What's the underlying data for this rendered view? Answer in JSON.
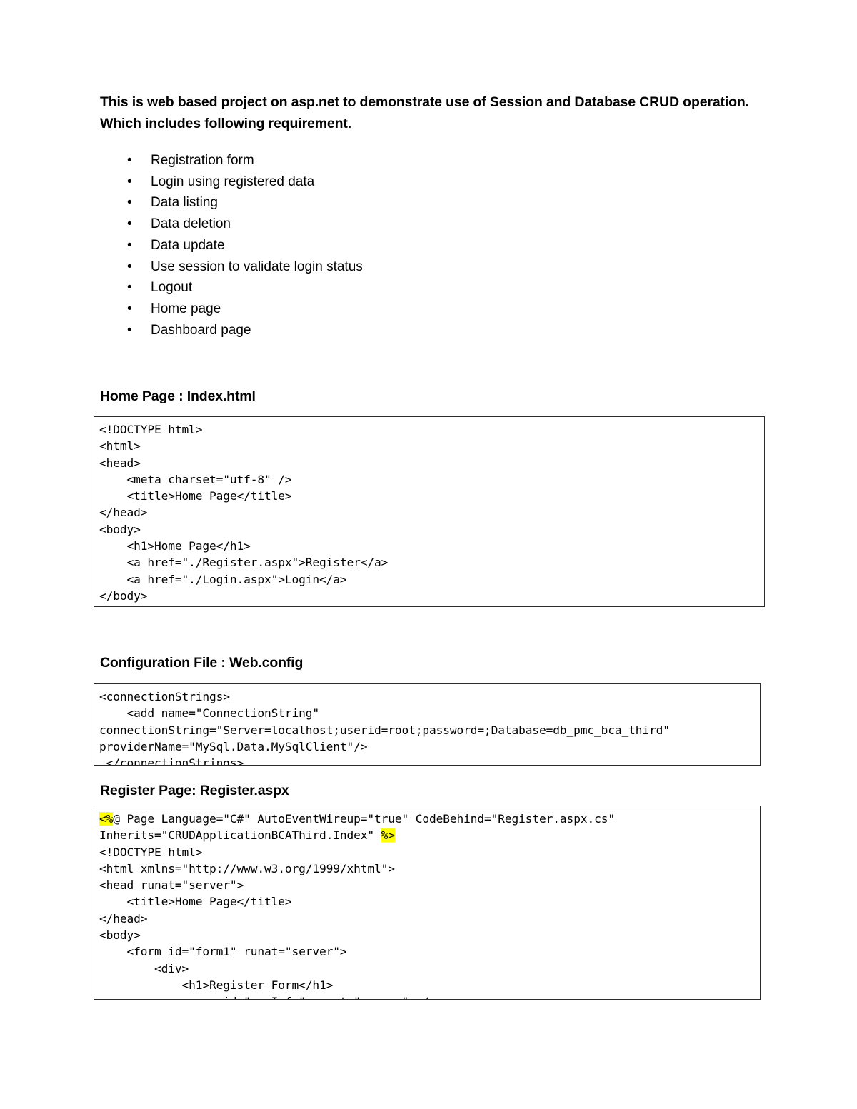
{
  "document": {
    "intro": {
      "line1": "This is web based project on asp.net to demonstrate use of Session and Database CRUD operation.",
      "line2": "Which includes following requirement."
    },
    "bullet_glyph": "•",
    "requirements": [
      "Registration form",
      "Login using registered data",
      "Data listing",
      "Data deletion",
      "Data update",
      "Use session to validate login status",
      "Logout",
      "Home page",
      "Dashboard page"
    ],
    "sections": [
      {
        "heading": "Home Page : Index.html",
        "code_id": "code-index",
        "code": "<!DOCTYPE html>\n<html>\n<head>\n    <meta charset=\"utf-8\" />\n    <title>Home Page</title>\n</head>\n<body>\n    <h1>Home Page</h1>\n    <a href=\"./Register.aspx\">Register</a>\n    <a href=\"./Login.aspx\">Login</a>\n</body>\n</html>"
      },
      {
        "heading": "Configuration File : Web.config",
        "code_id": "code-webconfig",
        "code": "<connectionStrings>\n    <add name=\"ConnectionString\"\nconnectionString=\"Server=localhost;userid=root;password=;Database=db_pmc_bca_third\"\nproviderName=\"MySql.Data.MySqlClient\"/>\n </connectionStrings>"
      },
      {
        "heading": "Register Page: Register.aspx",
        "code_id": "code-register",
        "code_before_highlight1": "",
        "highlight1": "<%",
        "code_mid": "@ Page Language=\"C#\" AutoEventWireup=\"true\" CodeBehind=\"Register.aspx.cs\"\nInherits=\"CRUDApplicationBCAThird.Index\" ",
        "highlight2": "%>",
        "code_after": "\n<!DOCTYPE html>\n<html xmlns=\"http://www.w3.org/1999/xhtml\">\n<head runat=\"server\">\n    <title>Home Page</title>\n</head>\n<body>\n    <form id=\"form1\" runat=\"server\">\n        <div>\n            <h1>Register Form</h1>\n            <span id=\"msgInfo\" runat=\"server\"></span>"
      }
    ],
    "colors": {
      "highlight": "#FFFF00",
      "text": "#000000",
      "border": "#2B2B2B",
      "background": "#FFFFFF"
    }
  }
}
